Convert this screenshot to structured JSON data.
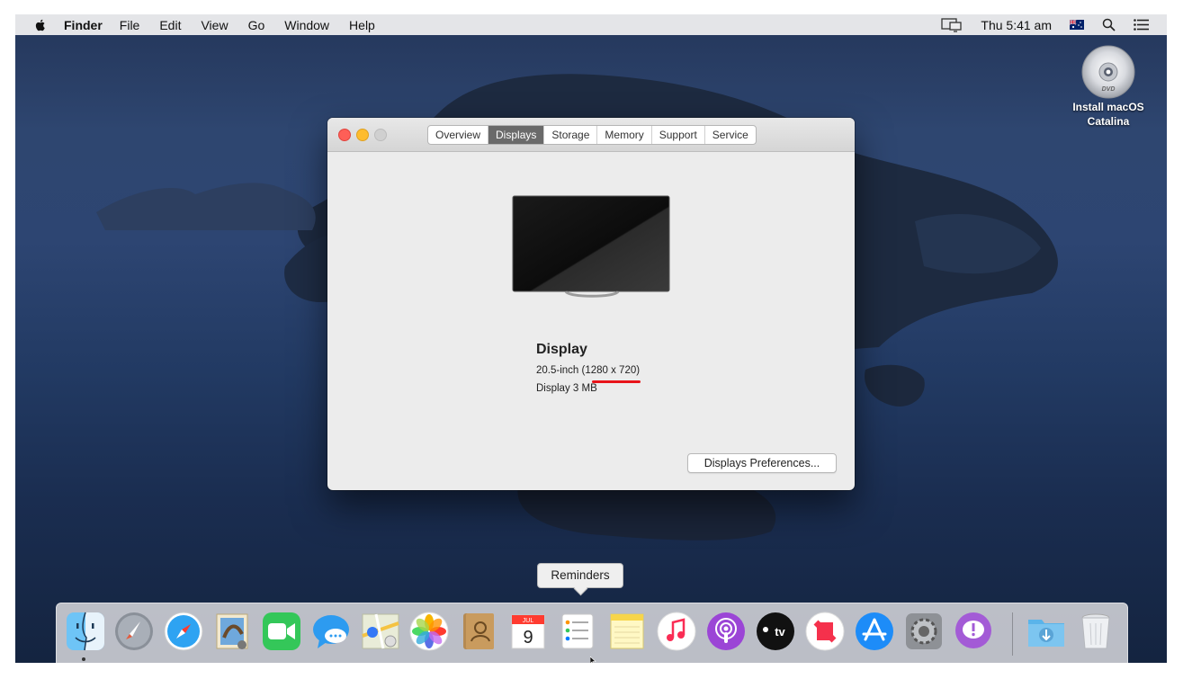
{
  "menubar": {
    "app_name": "Finder",
    "items": [
      "File",
      "Edit",
      "View",
      "Go",
      "Window",
      "Help"
    ],
    "clock": "Thu 5:41 am",
    "icons": [
      "apple-icon",
      "display-mirroring-icon",
      "australia-flag-icon",
      "spotlight-search-icon",
      "notification-center-icon"
    ]
  },
  "desktop": {
    "disk_label_line1": "Install macOS",
    "disk_label_line2": "Catalina",
    "disk_icon": "dvd-disk-icon"
  },
  "about_window": {
    "tabs": [
      "Overview",
      "Displays",
      "Storage",
      "Memory",
      "Support",
      "Service"
    ],
    "active_tab": "Displays",
    "display_title": "Display",
    "display_size": "20.5-inch (1280 x 720)",
    "display_memory": "Display 3 MB",
    "prefs_button": "Displays Preferences..."
  },
  "tooltip": "Reminders",
  "dock": {
    "apps": [
      "Finder",
      "Launchpad",
      "Safari",
      "Mail",
      "FaceTime",
      "Messages",
      "Maps",
      "Photos",
      "Contacts",
      "Calendar",
      "Reminders",
      "Notes",
      "Music",
      "Podcasts",
      "TV",
      "News",
      "App Store",
      "System Preferences",
      "Feedback Assistant",
      "Downloads",
      "Trash"
    ],
    "calendar_month": "JUL",
    "calendar_day": "9",
    "tv_label": "tv"
  },
  "colors": {
    "accent_red_underline": "#e8141a",
    "active_tab_bg": "#6a6a6a"
  }
}
